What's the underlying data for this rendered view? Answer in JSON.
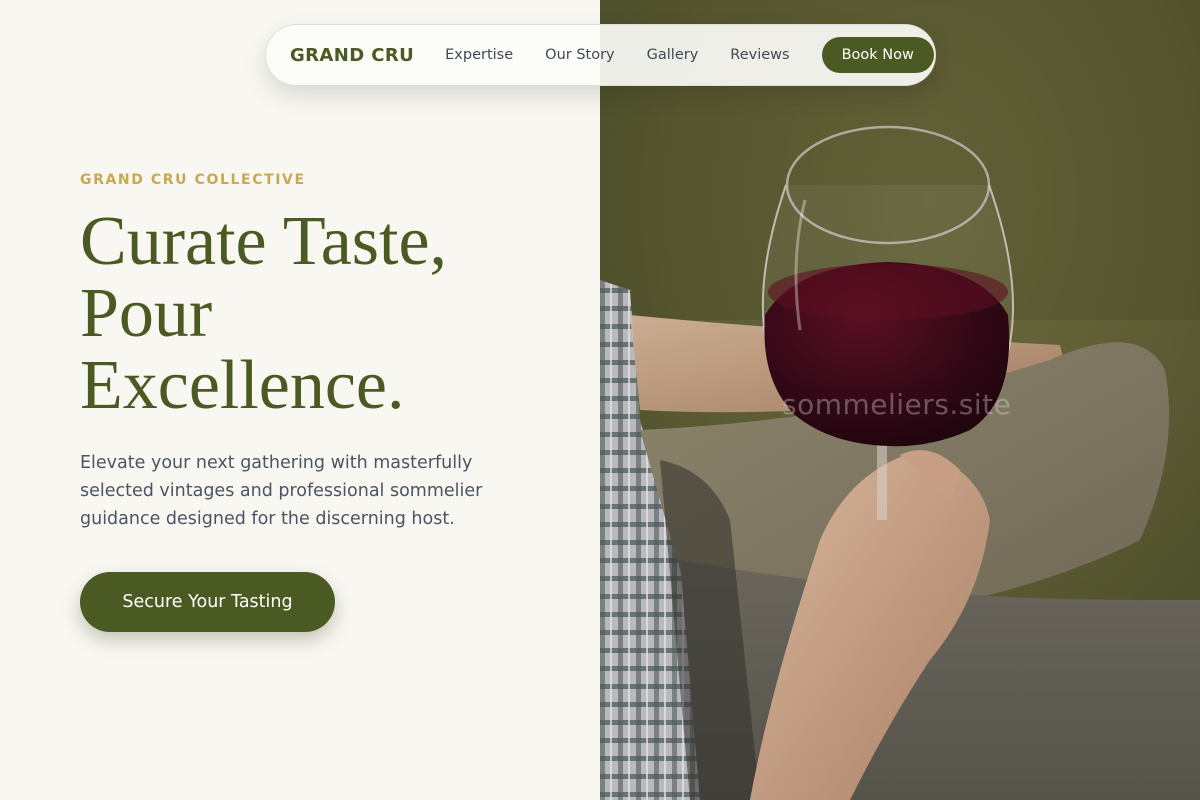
{
  "nav": {
    "brand": "GRAND CRU",
    "links": [
      {
        "label": "Expertise"
      },
      {
        "label": "Our Story"
      },
      {
        "label": "Gallery"
      },
      {
        "label": "Reviews"
      }
    ],
    "cta_label": "Book Now"
  },
  "hero": {
    "eyebrow": "GRAND CRU COLLECTIVE",
    "headline_lines": [
      "Curate Taste,",
      "Pour",
      "Excellence."
    ],
    "lead": "Elevate your next gathering with masterfully selected vintages and professional sommelier guidance designed for the discerning host.",
    "cta_label": "Secure Your Tasting"
  },
  "photo": {
    "subject": "wine-glass-in-hand",
    "watermark": "sommeliers.site"
  },
  "colors": {
    "brand_green": "#4b5a22",
    "gold": "#c9a94f",
    "background": "#f8f7f2",
    "body_text": "#4a5560",
    "wine": "#3a0b16"
  }
}
